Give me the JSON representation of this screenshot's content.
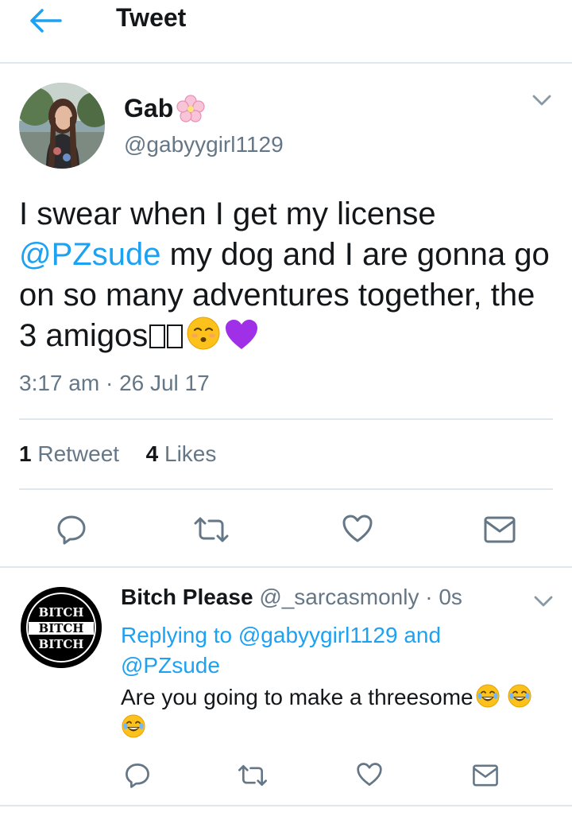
{
  "header": {
    "title": "Tweet",
    "back_icon": "arrow-left-icon"
  },
  "tweet": {
    "author_name": "Gab",
    "author_handle": "@gabyygirl1129",
    "text_part1": "I swear when I get my license ",
    "mention": "@PZsude",
    "text_part2": " my dog and I are gonna go on so many adventures together, the 3 amigos",
    "unsupported_glyphs": "\u0000\u0000",
    "time": "3:17 am",
    "dot": "·",
    "date": "26 Jul 17",
    "retweet_count": "1",
    "retweet_label": "Retweet",
    "like_count": "4",
    "like_label": "Likes"
  },
  "reply": {
    "author_name": "Bitch Please",
    "author_handle": "@_sarcasmonly",
    "dot": "·",
    "time": "0s",
    "replying_prefix": "Replying to ",
    "replying_to_1": "@gabyygirl1129",
    "replying_and": " and",
    "replying_to_2": "@PZsude",
    "text": "Are you going to make a threesome",
    "avatar_text": [
      "BITCH",
      "BITCH",
      "BITCH"
    ]
  },
  "colors": {
    "accent": "#1da1f2",
    "secondary": "#657786",
    "divider": "#e1e8ed",
    "heart_emoji": "#a02fe8"
  }
}
